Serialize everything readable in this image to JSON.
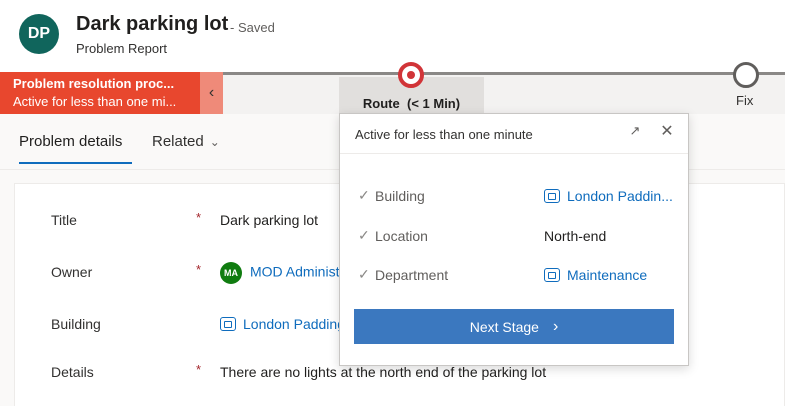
{
  "record": {
    "avatar_initials": "DP",
    "title": "Dark parking lot",
    "saved_status": "- Saved",
    "entity_type": "Problem Report"
  },
  "process": {
    "name": "Problem resolution proc...",
    "active_duration": "Active for less than one mi...",
    "collapse_icon": "chevron-left-icon",
    "stages": [
      {
        "label": "Route",
        "duration": "(< 1 Min)",
        "status": "active"
      },
      {
        "label": "Fix",
        "status": "inactive"
      }
    ]
  },
  "tabs": [
    {
      "label": "Problem details",
      "selected": true
    },
    {
      "label": "Related",
      "selected": false
    }
  ],
  "form": {
    "fields": [
      {
        "label": "Title",
        "required": "*",
        "value": "Dark parking lot"
      },
      {
        "label": "Owner",
        "required": "*",
        "value": "MOD Administ",
        "avatar": "MA"
      },
      {
        "label": "Building",
        "required": "",
        "value": "London Padding"
      },
      {
        "label": "Details",
        "required": "*",
        "value": "There are no lights at the north end of the parking lot"
      }
    ]
  },
  "flyout": {
    "title": "Active for less than one minute",
    "steps": [
      {
        "label": "Building",
        "value": "London Paddin..."
      },
      {
        "label": "Location",
        "value": "North-end"
      },
      {
        "label": "Department",
        "value": "Maintenance"
      }
    ],
    "next_button": "Next Stage"
  },
  "colors": {
    "accent": "#0f6cbd",
    "process_flag": "#e8472e",
    "active_stage": "#d13438",
    "next_button": "#3b78bf"
  }
}
